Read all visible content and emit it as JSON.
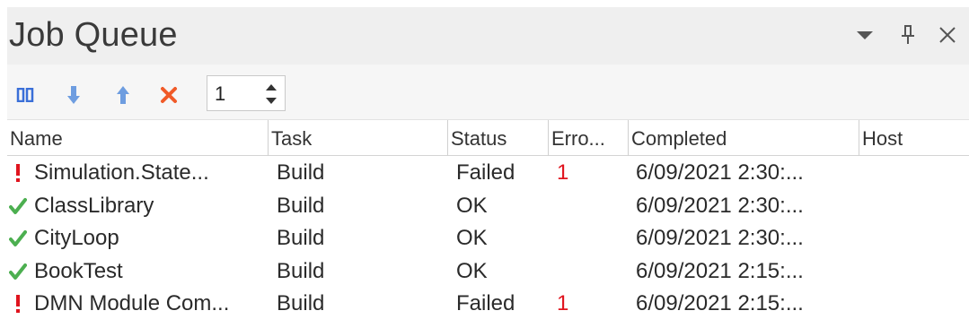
{
  "window": {
    "title": "Job Queue"
  },
  "titlebar_icons": [
    "dropdown-arrow-icon",
    "pin-icon",
    "close-icon"
  ],
  "toolbar": {
    "icons": [
      "pause-icon",
      "move-down-icon",
      "move-up-icon",
      "cancel-icon"
    ],
    "spinner_value": "1"
  },
  "columns": [
    "Name",
    "Task",
    "Status",
    "Erro...",
    "Completed",
    "Host"
  ],
  "rows": [
    {
      "icon": "error-icon",
      "name": "Simulation.State...",
      "task": "Build",
      "status": "Failed",
      "errors": "1",
      "completed": "6/09/2021 2:30:...",
      "host": ""
    },
    {
      "icon": "check-icon",
      "name": "ClassLibrary",
      "task": "Build",
      "status": "OK",
      "errors": "",
      "completed": "6/09/2021 2:30:...",
      "host": ""
    },
    {
      "icon": "check-icon",
      "name": "CityLoop",
      "task": "Build",
      "status": "OK",
      "errors": "",
      "completed": "6/09/2021 2:30:...",
      "host": ""
    },
    {
      "icon": "check-icon",
      "name": "BookTest",
      "task": "Build",
      "status": "OK",
      "errors": "",
      "completed": "6/09/2021 2:15:...",
      "host": ""
    },
    {
      "icon": "error-icon",
      "name": "DMN Module Com...",
      "task": "Build",
      "status": "Failed",
      "errors": "1",
      "completed": "6/09/2021 2:15:...",
      "host": ""
    }
  ],
  "colors": {
    "error": "#e0141e",
    "success": "#4caf50",
    "toolbar_icon_blue": "#5b8fd6",
    "cancel": "#f05a28",
    "titlebar_bg": "#efefef"
  }
}
